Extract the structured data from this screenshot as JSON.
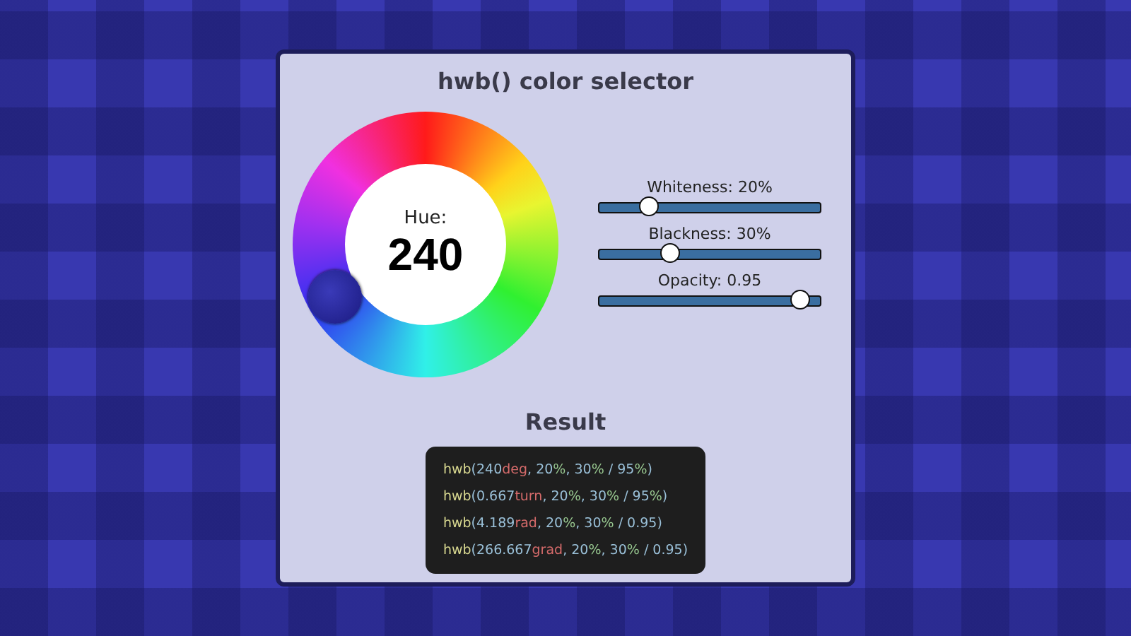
{
  "title": "hwb() color selector",
  "hue": {
    "label": "Hue:",
    "value": "240"
  },
  "sliders": [
    {
      "label": "Whiteness: 20%",
      "level": 0.2
    },
    {
      "label": "Blackness: 30%",
      "level": 0.3
    },
    {
      "label": "Opacity: 0.95",
      "level": 0.95
    }
  ],
  "result": {
    "heading": "Result",
    "lines": [
      [
        {
          "kind": "fn",
          "text": "hwb"
        },
        {
          "kind": "punct",
          "text": "("
        },
        {
          "kind": "num",
          "text": "240"
        },
        {
          "kind": "unit",
          "text": "deg"
        },
        {
          "kind": "punct",
          "text": ", "
        },
        {
          "kind": "num",
          "text": "20"
        },
        {
          "kind": "pct",
          "text": "%"
        },
        {
          "kind": "punct",
          "text": ", "
        },
        {
          "kind": "num",
          "text": "30"
        },
        {
          "kind": "pct",
          "text": "%"
        },
        {
          "kind": "punct",
          "text": " / "
        },
        {
          "kind": "num",
          "text": "95"
        },
        {
          "kind": "pct",
          "text": "%"
        },
        {
          "kind": "punct",
          "text": ")"
        }
      ],
      [
        {
          "kind": "fn",
          "text": "hwb"
        },
        {
          "kind": "punct",
          "text": "("
        },
        {
          "kind": "num",
          "text": "0.667"
        },
        {
          "kind": "unit",
          "text": "turn"
        },
        {
          "kind": "punct",
          "text": ", "
        },
        {
          "kind": "num",
          "text": "20"
        },
        {
          "kind": "pct",
          "text": "%"
        },
        {
          "kind": "punct",
          "text": ", "
        },
        {
          "kind": "num",
          "text": "30"
        },
        {
          "kind": "pct",
          "text": "%"
        },
        {
          "kind": "punct",
          "text": " / "
        },
        {
          "kind": "num",
          "text": "95"
        },
        {
          "kind": "pct",
          "text": "%"
        },
        {
          "kind": "punct",
          "text": ")"
        }
      ],
      [
        {
          "kind": "fn",
          "text": "hwb"
        },
        {
          "kind": "punct",
          "text": "("
        },
        {
          "kind": "num",
          "text": "4.189"
        },
        {
          "kind": "unit",
          "text": "rad"
        },
        {
          "kind": "punct",
          "text": ", "
        },
        {
          "kind": "num",
          "text": "20"
        },
        {
          "kind": "pct",
          "text": "%"
        },
        {
          "kind": "punct",
          "text": ", "
        },
        {
          "kind": "num",
          "text": "30"
        },
        {
          "kind": "pct",
          "text": "%"
        },
        {
          "kind": "punct",
          "text": " / "
        },
        {
          "kind": "num",
          "text": "0.95"
        },
        {
          "kind": "punct",
          "text": ")"
        }
      ],
      [
        {
          "kind": "fn",
          "text": "hwb"
        },
        {
          "kind": "punct",
          "text": "("
        },
        {
          "kind": "num",
          "text": "266.667"
        },
        {
          "kind": "unit",
          "text": "grad"
        },
        {
          "kind": "punct",
          "text": ", "
        },
        {
          "kind": "num",
          "text": "20"
        },
        {
          "kind": "pct",
          "text": "%"
        },
        {
          "kind": "punct",
          "text": ", "
        },
        {
          "kind": "num",
          "text": "30"
        },
        {
          "kind": "pct",
          "text": "%"
        },
        {
          "kind": "punct",
          "text": " / "
        },
        {
          "kind": "num",
          "text": "0.95"
        },
        {
          "kind": "punct",
          "text": ")"
        }
      ]
    ]
  }
}
